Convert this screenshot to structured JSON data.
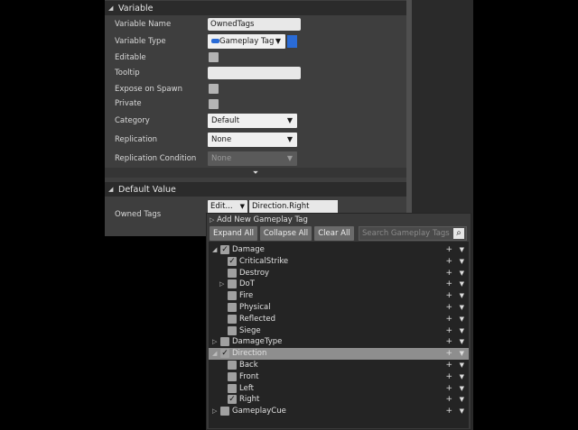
{
  "variable_section": {
    "title": "Variable",
    "rows": {
      "name": {
        "label": "Variable Name",
        "value": "OwnedTags"
      },
      "type": {
        "label": "Variable Type",
        "value": "Gameplay Tag"
      },
      "editable": {
        "label": "Editable"
      },
      "tooltip": {
        "label": "Tooltip",
        "value": ""
      },
      "expose": {
        "label": "Expose on Spawn"
      },
      "private": {
        "label": "Private"
      },
      "category": {
        "label": "Category",
        "value": "Default"
      },
      "replication": {
        "label": "Replication",
        "value": "None"
      },
      "replication_condition": {
        "label": "Replication Condition",
        "value": "None"
      }
    }
  },
  "default_section": {
    "title": "Default Value",
    "owned_tags_label": "Owned Tags",
    "edit_button": "Edit...",
    "current_tag": "Direction.Right"
  },
  "tag_picker": {
    "add_new": "Add New Gameplay Tag",
    "expand_all": "Expand All",
    "collapse_all": "Collapse All",
    "clear_all": "Clear All",
    "search_placeholder": "Search Gameplay Tags",
    "tags": [
      {
        "label": "Damage",
        "checked": true,
        "expanded": true
      },
      {
        "label": "CriticalStrike",
        "checked": true
      },
      {
        "label": "Destroy",
        "checked": false
      },
      {
        "label": "DoT",
        "checked": false,
        "expandable": true
      },
      {
        "label": "Fire",
        "checked": false
      },
      {
        "label": "Physical",
        "checked": false
      },
      {
        "label": "Reflected",
        "checked": false
      },
      {
        "label": "Siege",
        "checked": false
      },
      {
        "label": "DamageType",
        "checked": false,
        "expandable": true
      },
      {
        "label": "Direction",
        "checked": true,
        "expanded": true,
        "selected": true
      },
      {
        "label": "Back",
        "checked": false
      },
      {
        "label": "Front",
        "checked": false
      },
      {
        "label": "Left",
        "checked": false
      },
      {
        "label": "Right",
        "checked": true
      },
      {
        "label": "GameplayCue",
        "checked": false,
        "expandable": true
      }
    ]
  },
  "colors": {
    "type_pin": "#2a6bd6",
    "panel": "#3e3e3e",
    "selected_row": "#8e8e8e"
  }
}
